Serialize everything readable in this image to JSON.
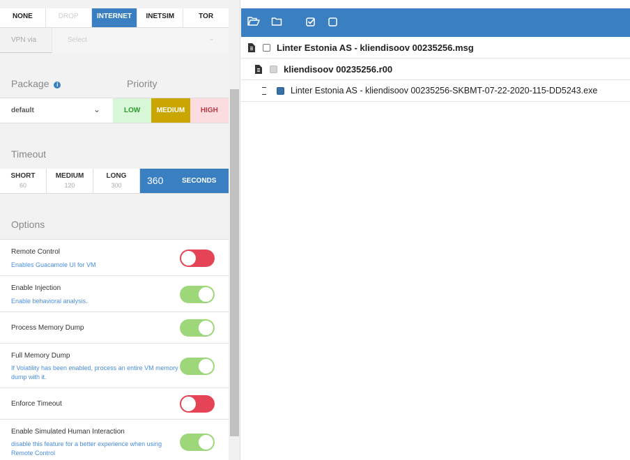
{
  "network": {
    "options": [
      {
        "label": "NONE",
        "state": "normal"
      },
      {
        "label": "DROP",
        "state": "disabled"
      },
      {
        "label": "INTERNET",
        "state": "active"
      },
      {
        "label": "INETSIM",
        "state": "normal"
      },
      {
        "label": "TOR",
        "state": "normal"
      }
    ],
    "vpn_label": "VPN via",
    "vpn_placeholder": "Select"
  },
  "package": {
    "label": "Package",
    "value": "default"
  },
  "priority": {
    "label": "Priority",
    "options": [
      "LOW",
      "MEDIUM",
      "HIGH"
    ],
    "selected": "MEDIUM"
  },
  "timeout": {
    "label": "Timeout",
    "presets": [
      {
        "name": "SHORT",
        "value": "60"
      },
      {
        "name": "MEDIUM",
        "value": "120"
      },
      {
        "name": "LONG",
        "value": "300"
      }
    ],
    "custom_value": "360",
    "custom_unit": "SECONDS"
  },
  "options": {
    "label": "Options",
    "items": [
      {
        "title": "Remote Control",
        "desc": "Enables Guacamole UI for VM",
        "enabled": false
      },
      {
        "title": "Enable Injection",
        "desc": "Enable behavioral analysis.",
        "enabled": true
      },
      {
        "title": "Process Memory Dump",
        "desc": "",
        "enabled": true
      },
      {
        "title": "Full Memory Dump",
        "desc": "If Volatility has been enabled, process an entire VM memory dump with it.",
        "enabled": true
      },
      {
        "title": "Enforce Timeout",
        "desc": "",
        "enabled": false
      },
      {
        "title": "Enable Simulated Human Interaction",
        "desc": "disable this feature for a better experience when using Remote Control",
        "enabled": true
      }
    ]
  },
  "colors": {
    "accent": "#3a7fc1",
    "toggle_on": "#9dd77a",
    "toggle_off": "#e54457",
    "medium": "#c9a700"
  },
  "tree": {
    "toolbar_icons": [
      "folder-open-icon",
      "folder-icon",
      "check-square-icon",
      "square-icon"
    ],
    "items": [
      {
        "label": "Linter Estonia AS - kliendisoov 00235256.msg",
        "level": 0,
        "checkbox": "empty"
      },
      {
        "label": "kliendisoov 00235256.r00",
        "level": 1,
        "checkbox": "grey"
      },
      {
        "label": "Linter Estonia AS - kliendisoov 00235256-SKBMT-07-22-2020-115-DD5243.exe",
        "level": 2,
        "checkbox": "checked"
      }
    ]
  }
}
